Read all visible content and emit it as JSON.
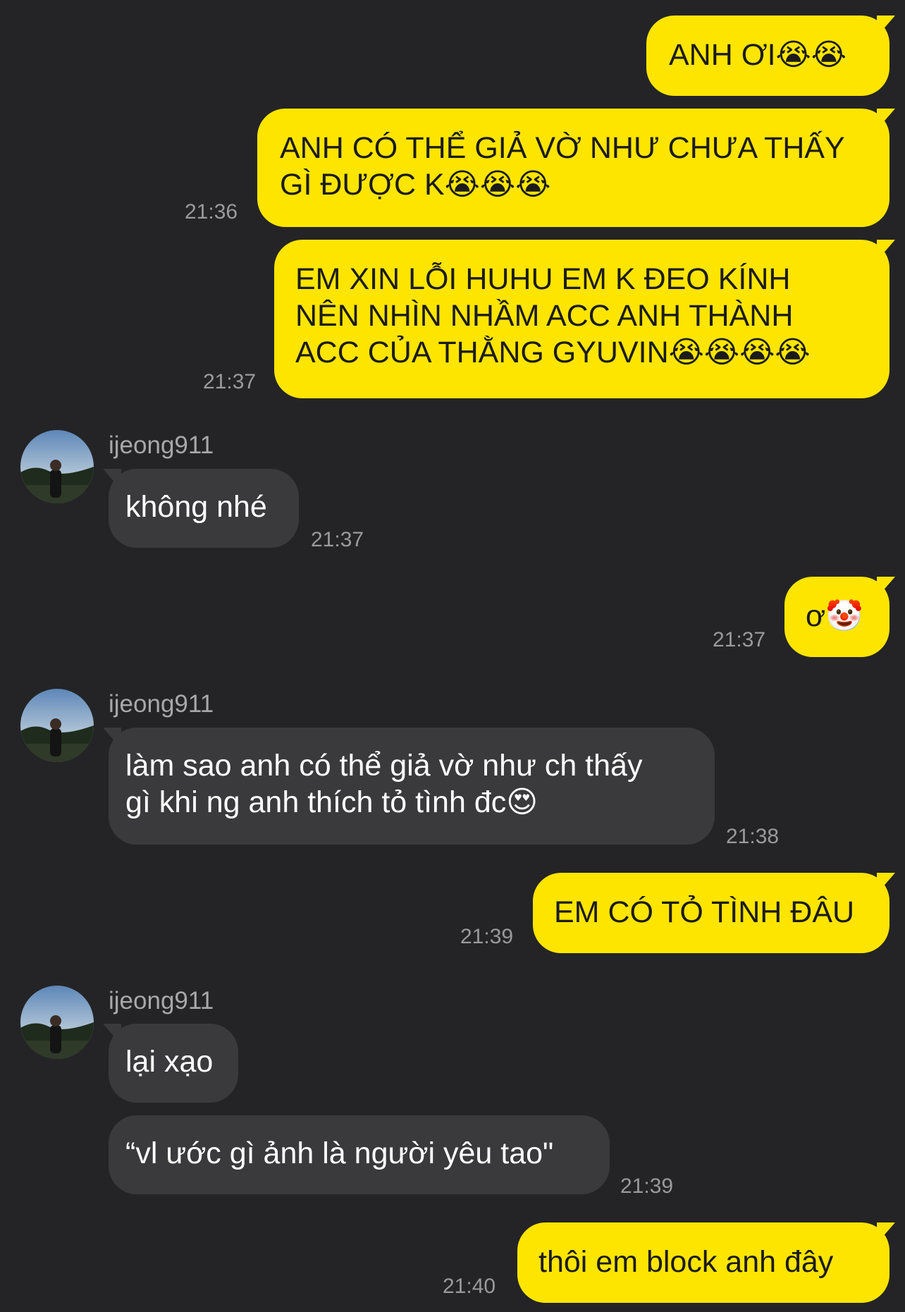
{
  "chat": {
    "contact_name": "ijeong911",
    "messages": [
      {
        "text": "ANH ƠI😭😭",
        "time": ""
      },
      {
        "text": "ANH CÓ THỂ GIẢ VỜ NHƯ CHƯA THẤY\nGÌ ĐƯỢC K😭😭😭",
        "time": "21:36"
      },
      {
        "text": "EM XIN LỖI HUHU EM K ĐEO KÍNH\nNÊN NHÌN NHẦM ACC ANH THÀNH\nACC CỦA THẰNG GYUVIN😭😭😭😭",
        "time": "21:37"
      },
      {
        "text": "không nhé",
        "time": "21:37"
      },
      {
        "text": "ơ🤡",
        "time": "21:37"
      },
      {
        "text": "làm sao anh có thể giả vờ như ch thấy\ngì khi ng anh thích tỏ tình đc😍",
        "time": "21:38"
      },
      {
        "text": "EM CÓ TỎ TÌNH ĐÂU",
        "time": "21:39"
      },
      {
        "text": "lại xạo",
        "time": ""
      },
      {
        "text": "“vl ước gì ảnh là người yêu tao\"",
        "time": "21:39"
      },
      {
        "text": "thôi em block anh đây",
        "time": "21:40"
      }
    ]
  },
  "colors": {
    "background": "#242426",
    "outgoing_bubble": "#fee500",
    "incoming_bubble": "#3a3a3c",
    "timestamp": "#9a9a9d"
  }
}
